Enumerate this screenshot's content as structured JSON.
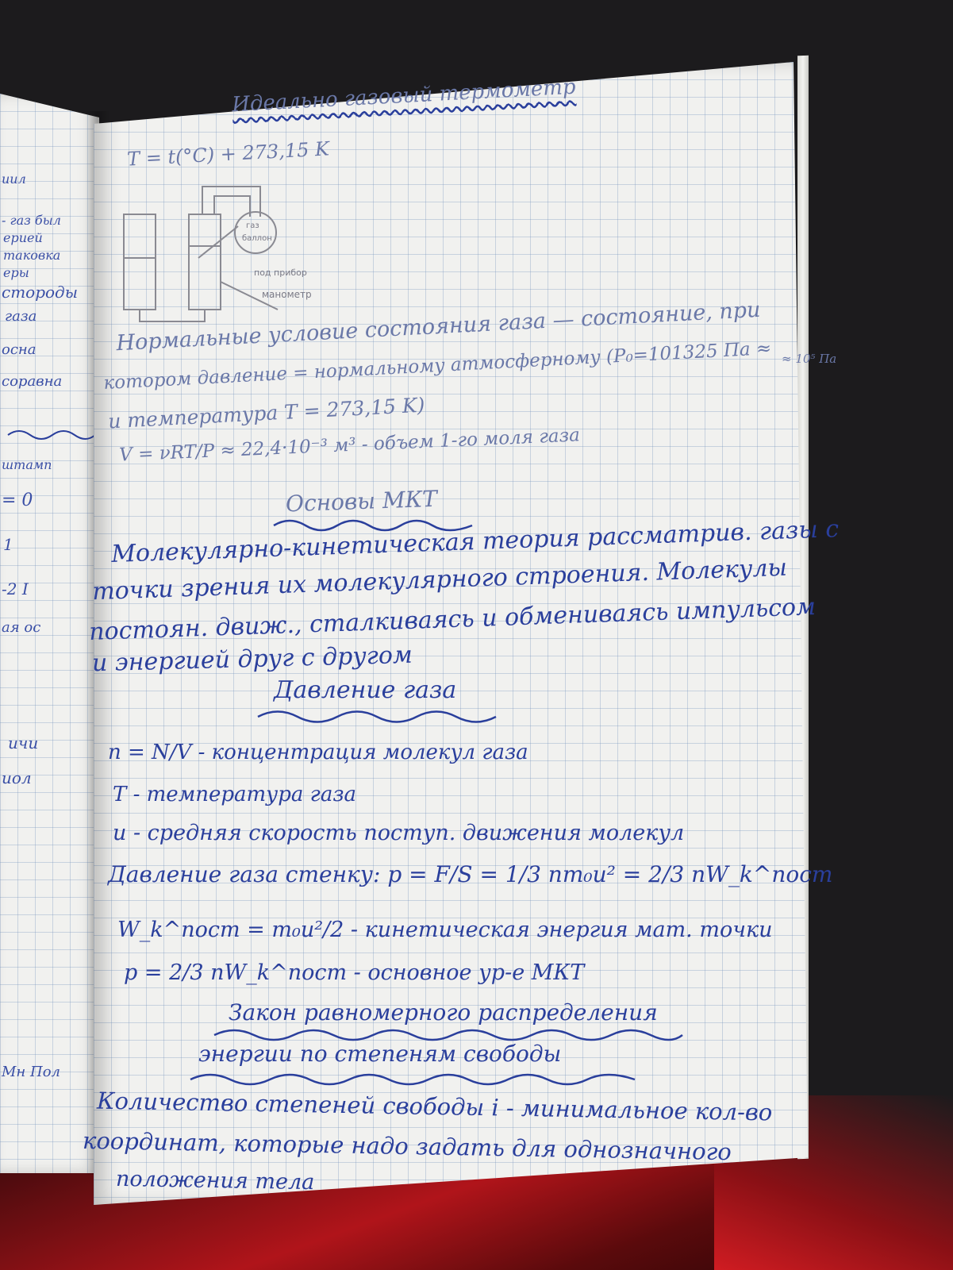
{
  "left_page": {
    "margin_notes": [
      "иил",
      "- газ был",
      "ерией",
      "таковка",
      "еры",
      "стороды",
      "газа",
      "осна",
      "соравна",
      "штамп",
      "= 0",
      "1",
      "-2 I",
      "ая ос",
      "ичи",
      "иол",
      "Мн Пол"
    ]
  },
  "notebook": {
    "title": "Идеально газовый термометр",
    "formula_temperature": "T = t(°C) + 273,15 K",
    "diagram_labels": [
      "газ",
      "баллон",
      "под прибор",
      "манометр"
    ],
    "normal_conditions": [
      "Нормальные условие состояния газа — состояние, при",
      "котором давление = нормальному атмосферному (P₀=101325 Па ≈",
      "и температура T = 273,15 K)"
    ],
    "pressure_note": "≈ 10⁵ Па",
    "molar_volume": "V = νRT/P ≈ 22,4·10⁻³ м³ - объем 1-го моля газа",
    "heading_mkt": "Основы МКТ",
    "mkt_text": [
      "Молекулярно-кинетическая теория рассматрив. газы с",
      "точки зрения их молекулярного строения. Молекулы",
      "постоян. движ., сталкиваясь и обмениваясь импульсом",
      "и энергией друг с другом"
    ],
    "heading_pressure": "Давление газа",
    "pressure_lines": [
      "n = N/V - концентрация молекул газа",
      "T - температура газа",
      "u - средняя скорость поступ. движения молекул",
      "Давление газа стенку: p = F/S = 1/3 nm₀u² = 2/3 nW_k^пост",
      "W_k^пост = m₀u²/2 - кинетическая энергия мат. точки",
      "p = 2/3 nW_k^пост - основное ур-е МКТ"
    ],
    "heading_equipartition": [
      "Закон равномерного распределения",
      "энергии по степеням свободы"
    ],
    "equipartition_text": [
      "Количество степеней свободы i - минимальное кол-во",
      "координат, которые надо задать для однозначного",
      "положения тела"
    ]
  }
}
